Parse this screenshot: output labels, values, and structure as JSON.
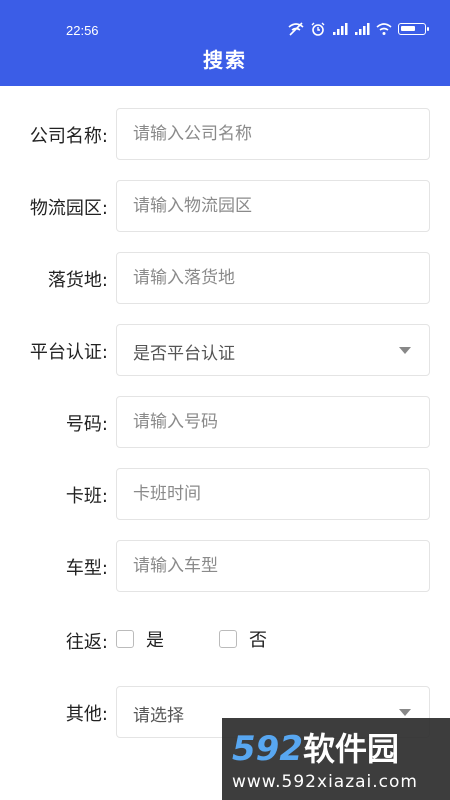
{
  "status_bar": {
    "time": "22:56"
  },
  "header": {
    "title": "搜索"
  },
  "form": {
    "company_name": {
      "label": "公司名称:",
      "placeholder": "请输入公司名称",
      "value": ""
    },
    "logistics_park": {
      "label": "物流园区:",
      "placeholder": "请输入物流园区",
      "value": ""
    },
    "destination": {
      "label": "落货地:",
      "placeholder": "请输入落货地",
      "value": ""
    },
    "platform_cert": {
      "label": "平台认证:",
      "selected": "是否平台认证"
    },
    "phone": {
      "label": "号码:",
      "placeholder": "请输入号码",
      "value": ""
    },
    "schedule": {
      "label": "卡班:",
      "placeholder": "卡班时间",
      "value": ""
    },
    "vehicle_type": {
      "label": "车型:",
      "placeholder": "请输入车型",
      "value": ""
    },
    "round_trip": {
      "label": "往返:",
      "options": [
        "是",
        "否"
      ]
    },
    "other": {
      "label": "其他:",
      "selected": "请选择"
    }
  },
  "watermark": {
    "logo": "592",
    "logo_cn": "软件园",
    "url": "www.592xiazai.com"
  },
  "colors": {
    "header": "#3b5de7",
    "watermark_blue": "#4aa0f0"
  },
  "icons": [
    "wifi-off-icon",
    "alarm-icon",
    "signal-icon",
    "wifi-icon",
    "battery-icon",
    "caret-down-icon"
  ]
}
